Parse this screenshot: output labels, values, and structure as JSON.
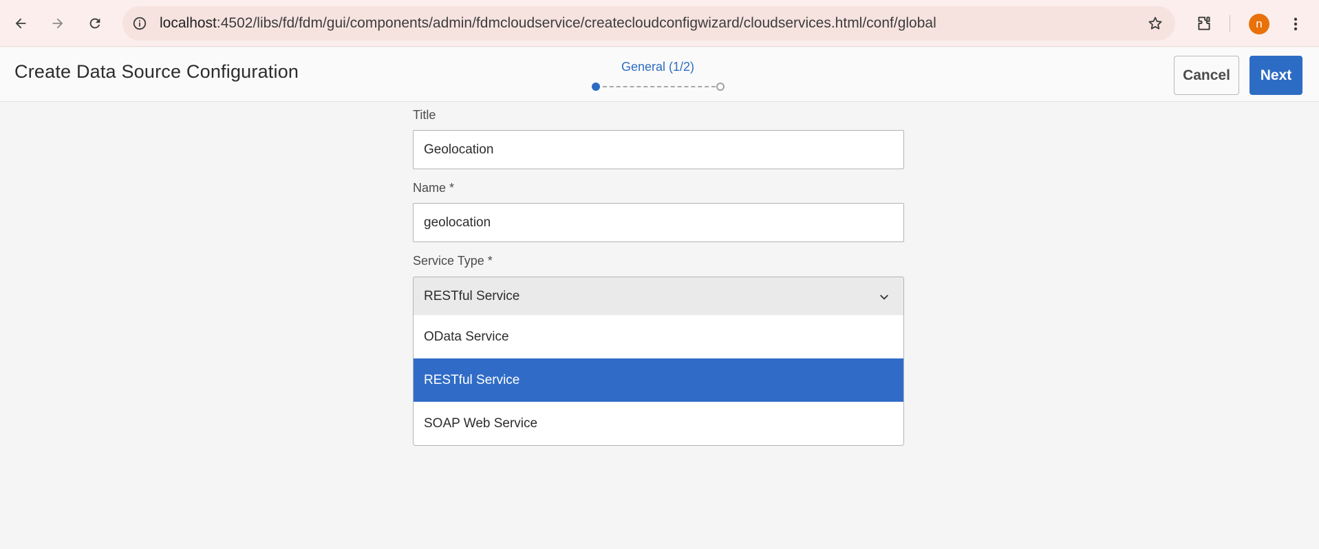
{
  "browser": {
    "url_host": "localhost",
    "url_path": ":4502/libs/fd/fdm/gui/components/admin/fdmcloudservice/createcloudconfigwizard/cloudservices.html/conf/global",
    "avatar_initial": "n",
    "icons": [
      "back-arrow-icon",
      "forward-arrow-icon",
      "reload-icon",
      "info-icon",
      "star-icon",
      "extensions-icon",
      "more-vert-icon"
    ]
  },
  "header": {
    "title": "Create Data Source Configuration",
    "step_label": "General (1/2)",
    "step_current": 1,
    "step_total": 2,
    "cancel_label": "Cancel",
    "next_label": "Next"
  },
  "form": {
    "title_label": "Title",
    "title_value": "Geolocation",
    "name_label": "Name *",
    "name_value": "geolocation",
    "service_type_label": "Service Type *",
    "service_type_value": "RESTful Service",
    "service_type_options": [
      {
        "label": "OData Service",
        "selected": false
      },
      {
        "label": "RESTful Service",
        "selected": true
      },
      {
        "label": "SOAP Web Service",
        "selected": false
      }
    ]
  },
  "colors": {
    "accent": "#2d6cc4",
    "selected_option_bg": "#306cc7",
    "avatar_bg": "#e8710a",
    "browser_bar_bg": "#fbeeec"
  }
}
